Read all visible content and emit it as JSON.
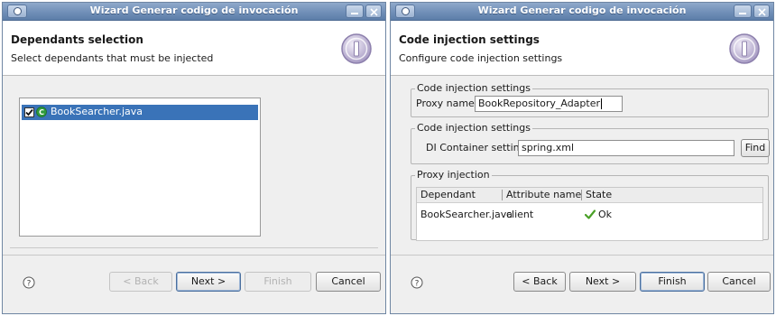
{
  "colors": {
    "titlebar": "#6e8db6",
    "selection": "#3a73b8",
    "window_bg": "#efefef",
    "ok_check": "#4aa027"
  },
  "window1": {
    "title": "Wizard Generar codigo de invocación",
    "header": {
      "title": "Dependants selection",
      "subtitle": "Select dependants that must be injected"
    },
    "dependants": [
      {
        "label": "BookSearcher.java",
        "checked": true,
        "selected": true,
        "icon": "class-icon"
      }
    ],
    "buttons": {
      "back": "< Back",
      "next": "Next >",
      "finish": "Finish",
      "cancel": "Cancel"
    }
  },
  "window2": {
    "title": "Wizard Generar codigo de invocación",
    "header": {
      "title": "Code injection settings",
      "subtitle": "Configure code injection settings"
    },
    "group_proxy": {
      "title": "Code injection settings",
      "label": "Proxy name",
      "value": "BookRepository_Adapter"
    },
    "group_di": {
      "title": "Code injection settings",
      "label": "DI Container settings",
      "value": "spring.xml",
      "find": "Find"
    },
    "group_table": {
      "title": "Proxy injection",
      "columns": [
        "Dependant",
        "Attribute name",
        "State"
      ],
      "rows": [
        {
          "dependant": "BookSearcher.java",
          "attribute": "client",
          "state": "Ok"
        }
      ]
    },
    "buttons": {
      "back": "< Back",
      "next": "Next >",
      "finish": "Finish",
      "cancel": "Cancel"
    }
  }
}
